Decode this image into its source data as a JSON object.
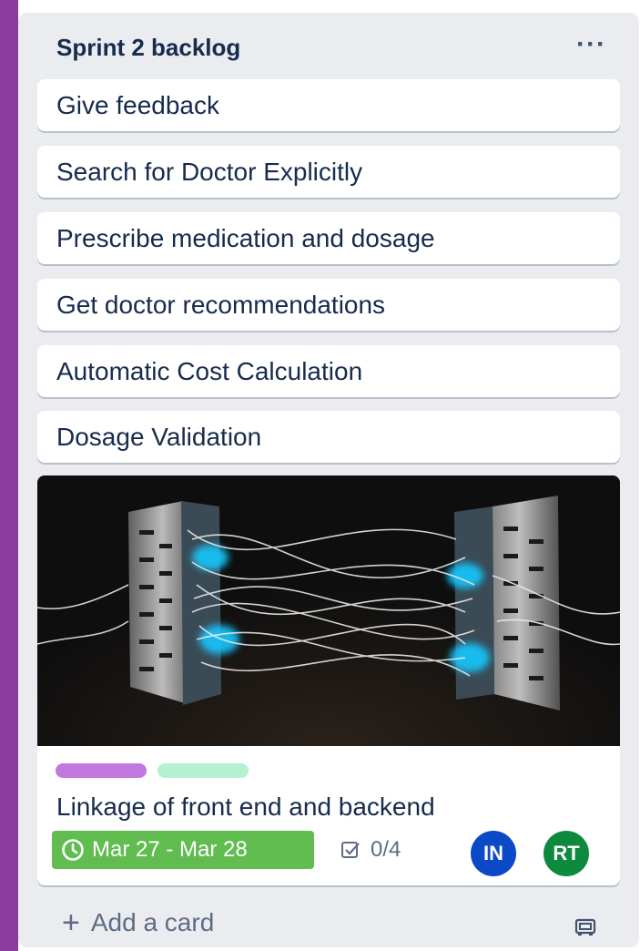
{
  "list": {
    "title": "Sprint 2 backlog",
    "menu_icon": "more-horizontal-icon"
  },
  "cards": [
    {
      "title": "Give feedback"
    },
    {
      "title": "Search for Doctor Explicitly"
    },
    {
      "title": "Prescribe medication and dosage"
    },
    {
      "title": "Get doctor recommendations"
    },
    {
      "title": "Automatic Cost Calculation"
    },
    {
      "title": "Dosage Validation"
    }
  ],
  "featured_card": {
    "cover_image": "server-racks-glowing-cables-image",
    "labels": [
      {
        "color": "#c377e0"
      },
      {
        "color": "#b3f1d0"
      }
    ],
    "title": "Linkage of front end and backend",
    "due_date": "Mar 27 - Mar 28",
    "due_color": "#61bd4f",
    "checklist": "0/4",
    "members": [
      {
        "initials": "IN",
        "color": "#0c49c6"
      },
      {
        "initials": "RT",
        "color": "#0e8a3f"
      }
    ]
  },
  "footer": {
    "add_label": "Add a card",
    "template_icon": "card-template-icon"
  },
  "colors": {
    "board_edge": "#8a3b9c",
    "list_background": "#ebecf0",
    "text": "#172b4d"
  }
}
